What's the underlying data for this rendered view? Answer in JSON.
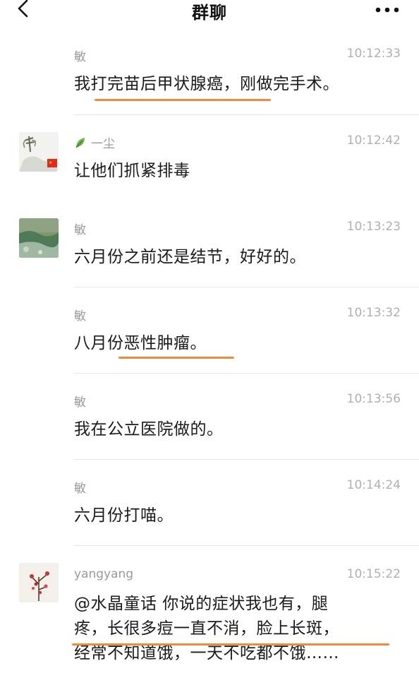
{
  "header": {
    "title": "群聊"
  },
  "messages": [
    {
      "sender": "敏",
      "time": "10:12:33",
      "text": "我打完苗后甲状腺癌，刚做完手术。"
    },
    {
      "sender": "一尘",
      "time": "10:12:42",
      "text": "让他们抓紧排毒"
    },
    {
      "sender": "敏",
      "time": "10:13:23",
      "text": "六月份之前还是结节，好好的。"
    },
    {
      "sender": "敏",
      "time": "10:13:32",
      "text": "八月份恶性肿瘤。"
    },
    {
      "sender": "敏",
      "time": "10:13:56",
      "text": "我在公立医院做的。"
    },
    {
      "sender": "敏",
      "time": "10:14:24",
      "text": "六月份打喵。"
    },
    {
      "sender": "yangyang",
      "time": "10:15:22",
      "lines": [
        "@水晶童话 你说的症状我也有，腿",
        "疼，长很多痘一直不消，脸上长斑，",
        "经常不知道饿，一天不吃都不饿……"
      ]
    }
  ],
  "colors": {
    "highlight": "#ee8b3e",
    "time": "#b0b0b0",
    "sender": "#9a9a9a"
  },
  "icons": {
    "back": "chevron-left-icon",
    "more": "more-dots-icon",
    "leaf": "leaf-icon",
    "flag": "china-flag-icon"
  }
}
